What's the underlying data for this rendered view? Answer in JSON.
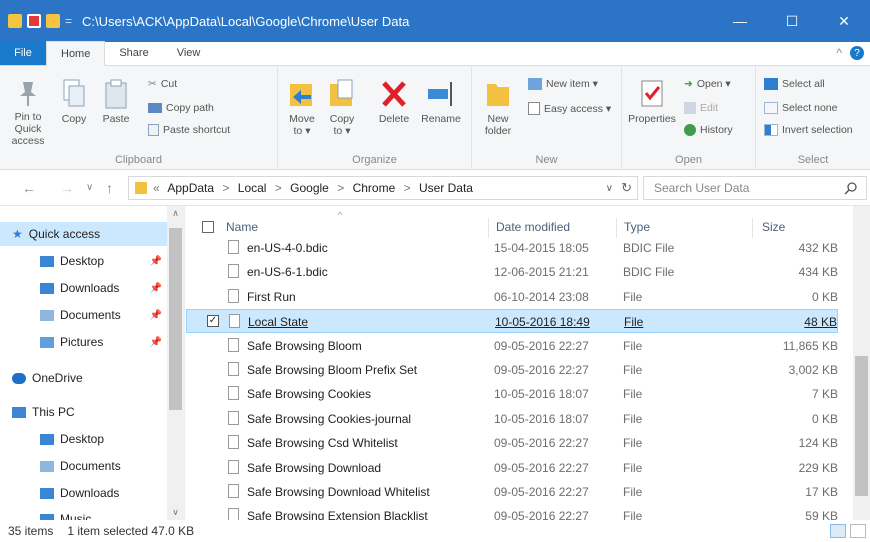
{
  "window": {
    "title": "C:\\Users\\ACK\\AppData\\Local\\Google\\Chrome\\User Data",
    "minimize": "—",
    "maximize": "☐",
    "close": "✕"
  },
  "tabs": {
    "file": "File",
    "home": "Home",
    "share": "Share",
    "view": "View"
  },
  "ribbon": {
    "clipboard": {
      "label": "Clipboard",
      "pin": "Pin to Quick access",
      "copy": "Copy",
      "paste": "Paste",
      "cut": "Cut",
      "copy_path": "Copy path",
      "paste_shortcut": "Paste shortcut"
    },
    "organize": {
      "label": "Organize",
      "move_to": "Move to ▾",
      "copy_to": "Copy to ▾",
      "delete": "Delete",
      "rename": "Rename"
    },
    "new": {
      "label": "New",
      "new_folder": "New folder",
      "new_item": "New item ▾",
      "easy_access": "Easy access ▾"
    },
    "open": {
      "label": "Open",
      "properties": "Properties",
      "open": "Open ▾",
      "edit": "Edit",
      "history": "History"
    },
    "select": {
      "label": "Select",
      "select_all": "Select all",
      "select_none": "Select none",
      "invert": "Invert selection"
    }
  },
  "nav": {
    "crumbs": [
      "«",
      "AppData",
      ">",
      "Local",
      ">",
      "Google",
      ">",
      "Chrome",
      ">",
      "User Data"
    ],
    "search_placeholder": "Search User Data"
  },
  "sidebar": {
    "items": [
      {
        "label": "Quick access",
        "pinned": false
      },
      {
        "label": "Desktop",
        "pinned": true
      },
      {
        "label": "Downloads",
        "pinned": true
      },
      {
        "label": "Documents",
        "pinned": true
      },
      {
        "label": "Pictures",
        "pinned": true
      },
      {
        "label": "OneDrive",
        "pinned": false
      },
      {
        "label": "This PC",
        "pinned": false
      },
      {
        "label": "Desktop",
        "pinned": false
      },
      {
        "label": "Documents",
        "pinned": false
      },
      {
        "label": "Downloads",
        "pinned": false
      },
      {
        "label": "Music",
        "pinned": false
      }
    ]
  },
  "columns": {
    "name": "Name",
    "date": "Date modified",
    "type": "Type",
    "size": "Size"
  },
  "files": [
    {
      "name": "en-US-4-0.bdic",
      "date": "15-04-2015 18:05",
      "type": "BDIC File",
      "size": "432 KB"
    },
    {
      "name": "en-US-6-1.bdic",
      "date": "12-06-2015 21:21",
      "type": "BDIC File",
      "size": "434 KB"
    },
    {
      "name": "First Run",
      "date": "06-10-2014 23:08",
      "type": "File",
      "size": "0 KB"
    },
    {
      "name": "Local State",
      "date": "10-05-2016 18:49",
      "type": "File",
      "size": "48 KB"
    },
    {
      "name": "Safe Browsing Bloom",
      "date": "09-05-2016 22:27",
      "type": "File",
      "size": "11,865 KB"
    },
    {
      "name": "Safe Browsing Bloom Prefix Set",
      "date": "09-05-2016 22:27",
      "type": "File",
      "size": "3,002 KB"
    },
    {
      "name": "Safe Browsing Cookies",
      "date": "10-05-2016 18:07",
      "type": "File",
      "size": "7 KB"
    },
    {
      "name": "Safe Browsing Cookies-journal",
      "date": "10-05-2016 18:07",
      "type": "File",
      "size": "0 KB"
    },
    {
      "name": "Safe Browsing Csd Whitelist",
      "date": "09-05-2016 22:27",
      "type": "File",
      "size": "124 KB"
    },
    {
      "name": "Safe Browsing Download",
      "date": "09-05-2016 22:27",
      "type": "File",
      "size": "229 KB"
    },
    {
      "name": "Safe Browsing Download Whitelist",
      "date": "09-05-2016 22:27",
      "type": "File",
      "size": "17 KB"
    },
    {
      "name": "Safe Browsing Extension Blacklist",
      "date": "09-05-2016 22:27",
      "type": "File",
      "size": "59 KB"
    }
  ],
  "status": {
    "count": "35 items",
    "selection": "1 item selected  47.0 KB"
  },
  "colors": {
    "titlebar": "#2b74c6",
    "selection": "#cce8ff",
    "accent": "#1979ca"
  }
}
